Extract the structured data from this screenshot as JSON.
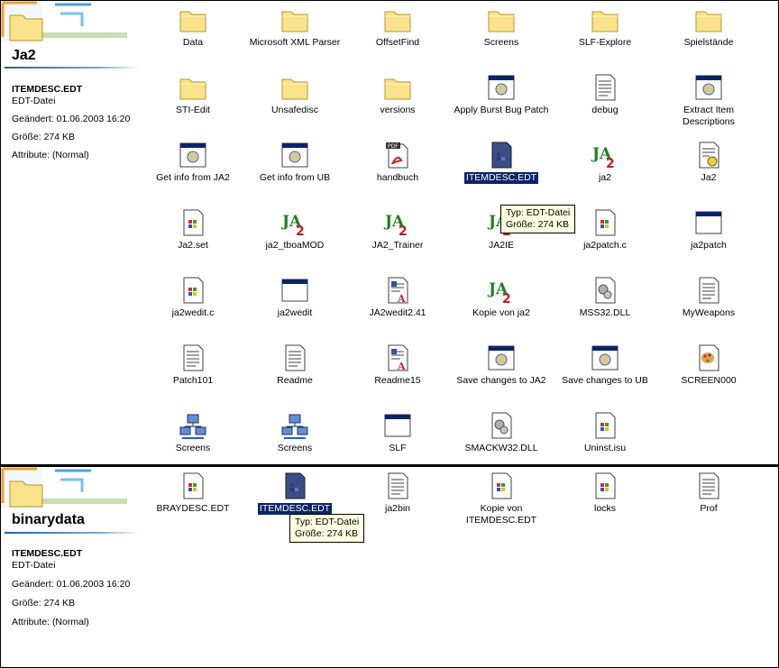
{
  "top": {
    "folder_title": "Ja2",
    "info": {
      "filename": "ITEMDESC.EDT",
      "type": "EDT-Datei",
      "modified": "Geändert: 01.06.2003 16:20",
      "size": "Größe: 274 KB",
      "attributes": "Attribute: (Normal)"
    },
    "items": [
      {
        "label": "Data",
        "icon": "folder-icon"
      },
      {
        "label": "Microsoft XML Parser",
        "icon": "folder-icon"
      },
      {
        "label": "OffsetFind",
        "icon": "folder-icon"
      },
      {
        "label": "Screens",
        "icon": "folder-icon"
      },
      {
        "label": "SLF-Explore",
        "icon": "folder-icon"
      },
      {
        "label": "Spielstände",
        "icon": "folder-icon"
      },
      {
        "label": "STI-Edit",
        "icon": "folder-icon"
      },
      {
        "label": "Unsafedisc",
        "icon": "folder-icon"
      },
      {
        "label": "versions",
        "icon": "folder-icon"
      },
      {
        "label": "Apply Burst Bug Patch",
        "icon": "batch-icon"
      },
      {
        "label": "debug",
        "icon": "text-doc-icon"
      },
      {
        "label": "Extract Item Descriptions",
        "icon": "batch-icon"
      },
      {
        "label": "Get info from JA2",
        "icon": "batch-icon"
      },
      {
        "label": "Get info from UB",
        "icon": "batch-icon"
      },
      {
        "label": "handbuch",
        "icon": "pdf-icon"
      },
      {
        "label": "ITEMDESC.EDT",
        "icon": "edt-file-icon",
        "selected": true
      },
      {
        "label": "ja2",
        "icon": "ja2-app-icon"
      },
      {
        "label": "Ja2",
        "icon": "config-icon"
      },
      {
        "label": "Ja2.set",
        "icon": "windows-file-icon"
      },
      {
        "label": "ja2_tboaMOD",
        "icon": "ja2-app-icon"
      },
      {
        "label": "JA2_Trainer",
        "icon": "ja2-app-icon"
      },
      {
        "label": "JA2IE",
        "icon": "ja2-app-icon"
      },
      {
        "label": "ja2patch.c",
        "icon": "windows-file-icon"
      },
      {
        "label": "ja2patch",
        "icon": "window-app-icon"
      },
      {
        "label": "ja2wedit.c",
        "icon": "windows-file-icon"
      },
      {
        "label": "ja2wedit",
        "icon": "window-app-icon"
      },
      {
        "label": "JA2wedit2.41",
        "icon": "wordpad-icon"
      },
      {
        "label": "Kopie von ja2",
        "icon": "ja2-app-icon"
      },
      {
        "label": "MSS32.DLL",
        "icon": "dll-icon"
      },
      {
        "label": "MyWeapons",
        "icon": "text-doc-icon"
      },
      {
        "label": "Patch101",
        "icon": "text-doc-icon"
      },
      {
        "label": "Readme",
        "icon": "text-doc-icon"
      },
      {
        "label": "Readme15",
        "icon": "wordpad-icon"
      },
      {
        "label": "Save changes to JA2",
        "icon": "batch-icon"
      },
      {
        "label": "Save changes to UB",
        "icon": "batch-icon"
      },
      {
        "label": "SCREEN000",
        "icon": "paint-icon"
      },
      {
        "label": "Screens",
        "icon": "network-icon"
      },
      {
        "label": "Screens",
        "icon": "network-icon"
      },
      {
        "label": "SLF",
        "icon": "window-app-icon"
      },
      {
        "label": "SMACKW32.DLL",
        "icon": "dll-icon"
      },
      {
        "label": "Uninst.isu",
        "icon": "windows-file-icon"
      }
    ],
    "tooltip": {
      "line1": "Typ: EDT-Datei",
      "line2": "Größe: 274 KB"
    }
  },
  "bottom": {
    "folder_title": "binarydata",
    "info": {
      "filename": "ITEMDESC.EDT",
      "type": "EDT-Datei",
      "modified": "Geändert: 01.06.2003 16:20",
      "size": "Größe: 274 KB",
      "attributes": "Attribute: (Normal)"
    },
    "items": [
      {
        "label": "BRAYDESC.EDT",
        "icon": "windows-file-icon"
      },
      {
        "label": "ITEMDESC.EDT",
        "icon": "edt-file-icon",
        "selected": true
      },
      {
        "label": "ja2bin",
        "icon": "text-doc-icon"
      },
      {
        "label": "Kopie von ITEMDESC.EDT",
        "icon": "windows-file-icon"
      },
      {
        "label": "locks",
        "icon": "windows-file-icon"
      },
      {
        "label": "Prof",
        "icon": "text-doc-icon"
      }
    ],
    "tooltip": {
      "line1": "Typ: EDT-Datei",
      "line2": "Größe: 274 KB"
    }
  },
  "colors": {
    "selection": "#0a246a",
    "tooltip_bg": "#ffffe1",
    "folder_yellow": "#f8e38a"
  }
}
